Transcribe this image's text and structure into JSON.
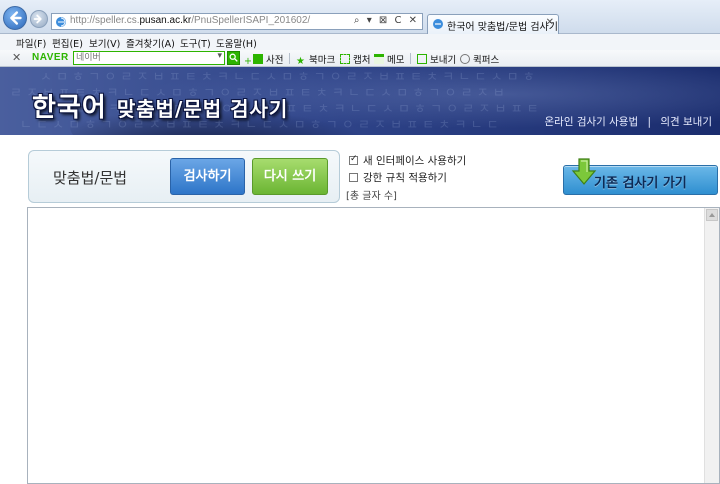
{
  "browser": {
    "url_prefix": "http://speller.cs.",
    "url_domain": "pusan.ac.kr",
    "url_path": "/PnuSpellerISAPI_201602/",
    "url_tools": "⌕ ▾ ⊠ C ✕",
    "tab_title": "한국어 맞춤법/문법 검사기",
    "tab_close": "✕"
  },
  "menu": {
    "items": [
      "파일(F)",
      "편집(E)",
      "보기(V)",
      "즐겨찾기(A)",
      "도구(T)",
      "도움말(H)"
    ]
  },
  "toolbar": {
    "close": "✕",
    "logo": "NAVER",
    "search_placeholder": "네이버",
    "search_dropdown": "▾",
    "dictionary": "사전",
    "bookmark": "북마크",
    "capture": "캡처",
    "memo": "메모",
    "send": "보내기",
    "quickpass": "퀵퍼스"
  },
  "banner": {
    "title_main": "한국어",
    "title_sub": "맞춤법/문법 검사기",
    "link_usage": "온라인 검사기 사용법",
    "link_separator": "|",
    "link_feedback": "의견 보내기"
  },
  "controls": {
    "section_title": "맞춤법/문법",
    "check_button": "검사하기",
    "reset_button": "다시 쓰기",
    "option_new_interface": "새 인터페이스 사용하기",
    "option_new_interface_checked": true,
    "option_strict_rules": "강한 규칙 적용하기",
    "option_strict_rules_checked": false,
    "char_count": "[총 글자 수]",
    "legacy_button": "기존 검사기 가기"
  },
  "colors": {
    "banner": "#2f4489",
    "check_button": "#2d75c8",
    "reset_button": "#6bb533",
    "naver_green": "#2db400"
  }
}
